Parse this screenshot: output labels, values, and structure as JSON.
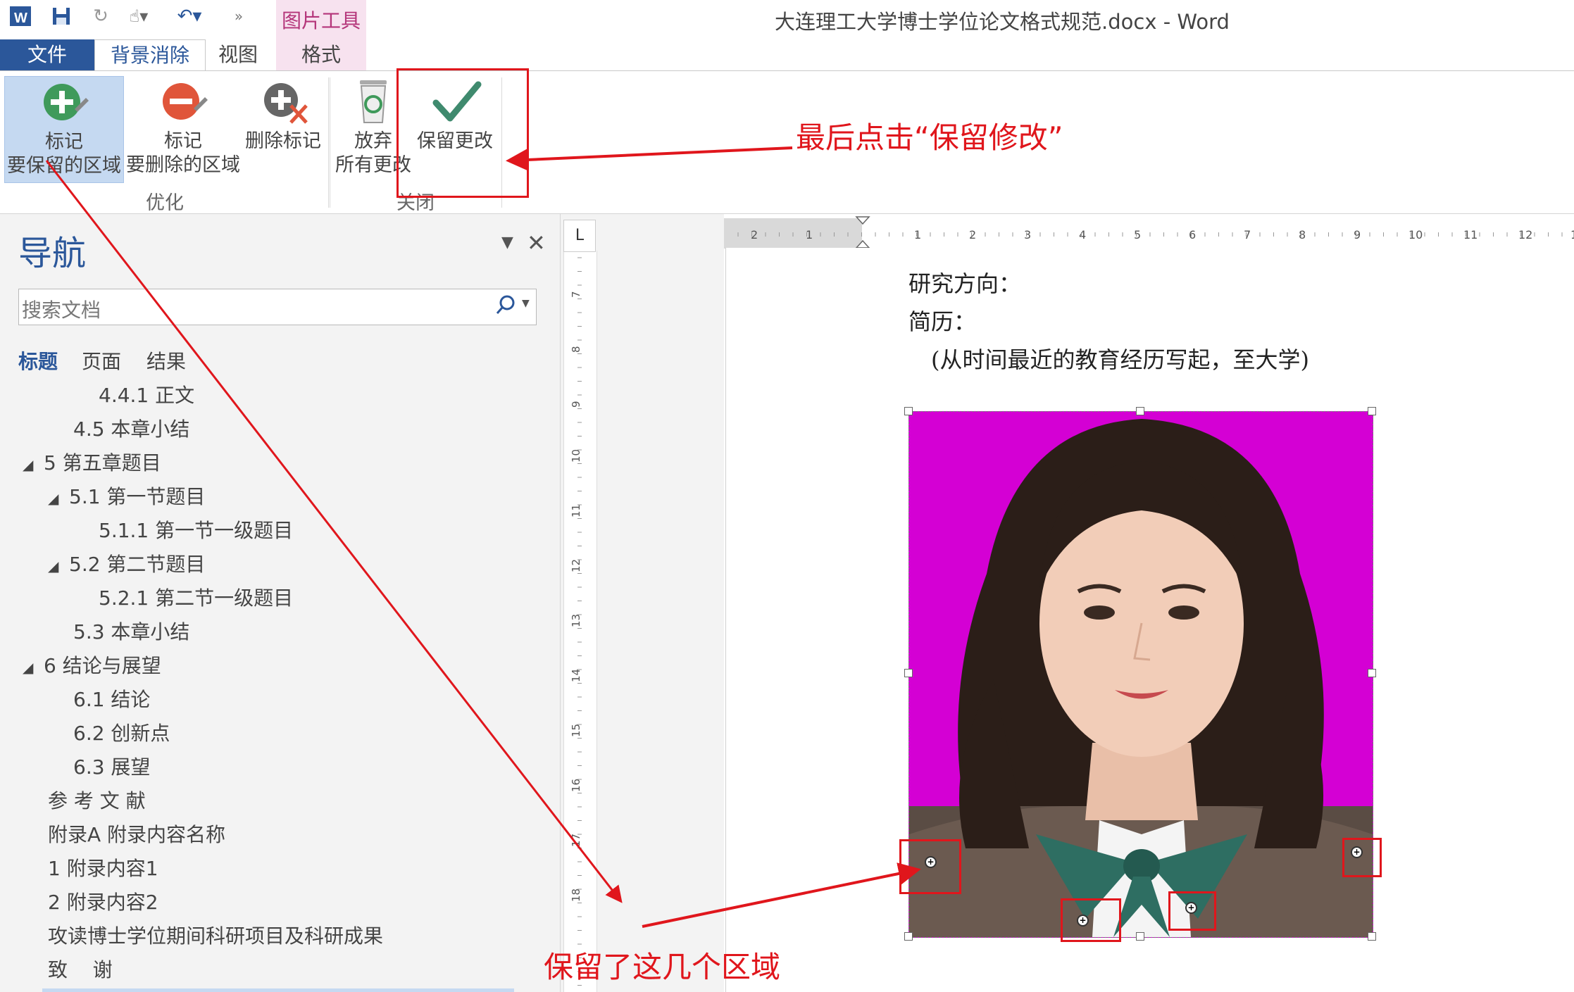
{
  "window": {
    "title": "大连理工大学博士学位论文格式规范.docx - Word"
  },
  "context_group": {
    "label": "图片工具"
  },
  "tabs": {
    "file": "文件",
    "background_removal": "背景消除",
    "view": "视图",
    "format": "格式"
  },
  "ribbon": {
    "mark_keep": {
      "line1": "标记",
      "line2": "要保留的区域"
    },
    "mark_remove": {
      "line1": "标记",
      "line2": "要删除的区域"
    },
    "delete_mark": {
      "label": "删除标记"
    },
    "discard": {
      "line1": "放弃",
      "line2": "所有更改"
    },
    "keep_changes": {
      "label": "保留更改"
    },
    "group_refine": "优化",
    "group_close": "关闭"
  },
  "nav": {
    "title": "导航",
    "search_placeholder": "搜索文档",
    "tabs": [
      "标题",
      "页面",
      "结果"
    ],
    "items": [
      {
        "text": "4.4.1  正文"
      },
      {
        "text": "4.5  本章小结"
      },
      {
        "text": "5  第五章题目"
      },
      {
        "text": "5.1  第一节题目"
      },
      {
        "text": "5.1.1  第一节一级题目"
      },
      {
        "text": "5.2  第二节题目"
      },
      {
        "text": "5.2.1  第二节一级题目"
      },
      {
        "text": "5.3  本章小结"
      },
      {
        "text": "6  结论与展望"
      },
      {
        "text": "6.1  结论"
      },
      {
        "text": "6.2  创新点"
      },
      {
        "text": "6.3  展望"
      },
      {
        "text": "参 考 文 献"
      },
      {
        "text": "附录A  附录内容名称"
      },
      {
        "text": "1  附录内容1"
      },
      {
        "text": "2  附录内容2"
      },
      {
        "text": "攻读博士学位期间科研项目及科研成果"
      },
      {
        "text": "致    谢"
      }
    ]
  },
  "ruler": {
    "h_labels": [
      "2",
      "1",
      "1",
      "2",
      "3",
      "4",
      "5",
      "6",
      "7",
      "8",
      "9",
      "10",
      "11",
      "12",
      "1"
    ],
    "v_labels": [
      "7",
      "8",
      "9",
      "10",
      "11",
      "12",
      "13",
      "14",
      "15",
      "16",
      "17",
      "18"
    ],
    "corner": "L"
  },
  "document": {
    "line1": "研究方向：",
    "line2": "简历：",
    "line3": "(从时间最近的教育经历写起，至大学)"
  },
  "annotations": {
    "top": "最后点击“保留修改”",
    "bottom": "保留了这几个区域"
  },
  "colors": {
    "accent": "#2b579a",
    "annotation_red": "#e0161c",
    "photo_bg": "#d400d4"
  }
}
